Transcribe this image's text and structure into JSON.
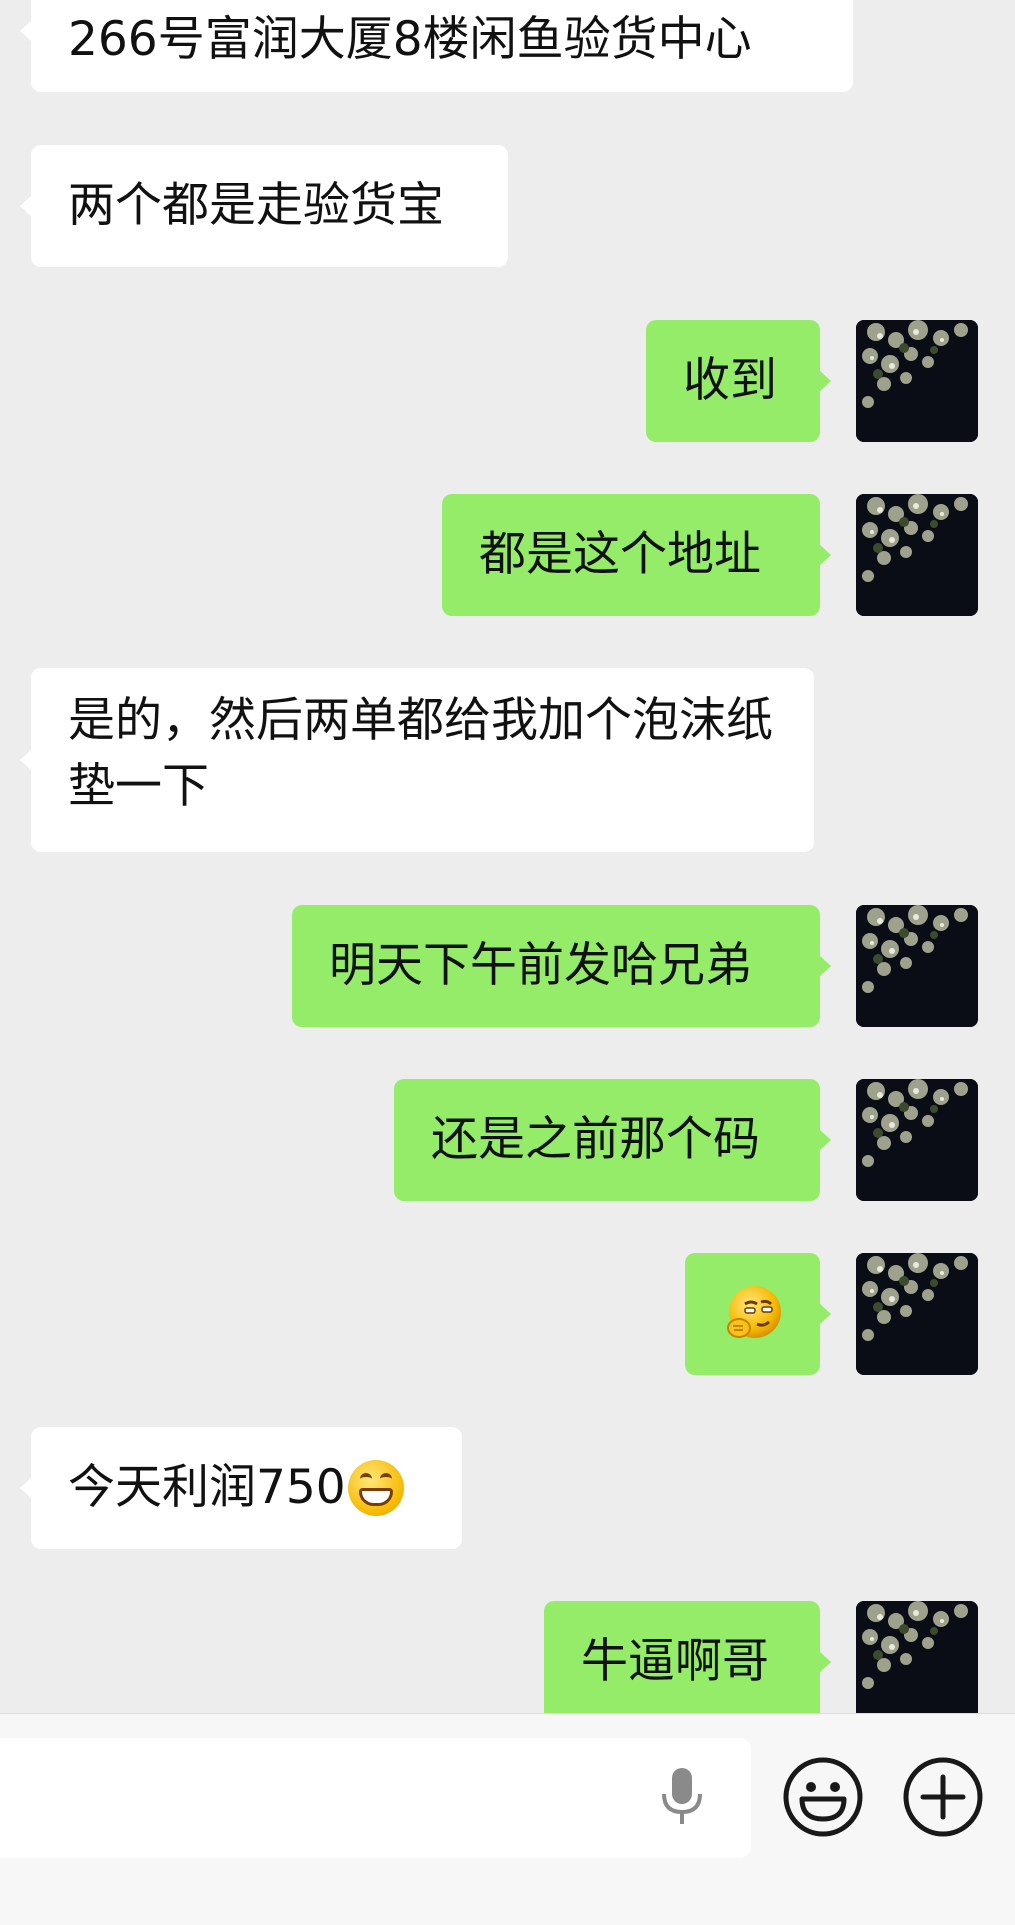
{
  "messages": [
    {
      "side": "in",
      "text": "266号富润大厦8楼闲鱼验货中心"
    },
    {
      "side": "in",
      "text": "两个都是走验货宝"
    },
    {
      "side": "out",
      "text": "收到"
    },
    {
      "side": "out",
      "text": "都是这个地址"
    },
    {
      "side": "in",
      "text": "是的，然后两单都给我加个泡沫纸垫一下"
    },
    {
      "side": "out",
      "text": "明天下午前发哈兄弟"
    },
    {
      "side": "out",
      "text": "还是之前那个码"
    },
    {
      "side": "out",
      "text": "",
      "emoji": "smirk-thinking-emoji"
    },
    {
      "side": "in",
      "text": "今天利润750",
      "emoji": "grin-emoji"
    },
    {
      "side": "out",
      "text": "牛逼啊哥"
    }
  ],
  "input_bar": {
    "placeholder": "",
    "icons": [
      "microphone-icon",
      "emoji-icon",
      "plus-icon"
    ]
  },
  "colors": {
    "background": "#ededed",
    "incoming_bubble": "#ffffff",
    "outgoing_bubble": "#95ec69",
    "bottom_bar": "#f7f7f7"
  }
}
